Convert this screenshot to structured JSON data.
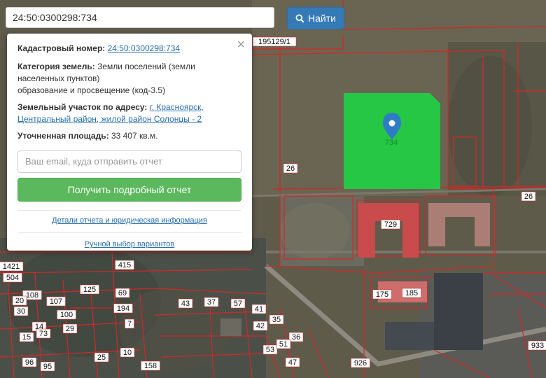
{
  "search": {
    "value": "24:50:0300298:734",
    "button_label": "Найти"
  },
  "popup": {
    "cadastral_label": "Кадастровый номер:",
    "cadastral_value": "24:50:0300298:734",
    "category_label": "Категория земель:",
    "category_value_1": "Земли поселений (земли населенных пунктов)",
    "category_value_2": "образование и просвещение (код-3.5)",
    "address_label": "Земельный участок по адресу:",
    "address_value": "г. Красноярск, Центральный район, жилой район Солонцы - 2",
    "area_label": "Уточненная площадь:",
    "area_value": "33 407 кв.м.",
    "email_placeholder": "Ваш email, куда отправить отчет",
    "report_button": "Получить подробный отчет",
    "details_link": "Детали отчета и юридическая информация",
    "manual_link": "Ручной выбор вариантов",
    "close_symbol": "×"
  },
  "map": {
    "selected_parcel_label": "734",
    "selected_color": "#22cc44",
    "parcel_line_color": "#cc2222",
    "marker_color": "#3b82c4",
    "parcel_labels": [
      "195129/1",
      "26",
      "26",
      "729",
      "185",
      "175",
      "415",
      "1421",
      "504",
      "108",
      "107",
      "100",
      "125",
      "69",
      "194",
      "43",
      "37",
      "57",
      "41",
      "35",
      "42",
      "36",
      "14",
      "29",
      "10",
      "73",
      "15",
      "7",
      "96",
      "95",
      "25",
      "158",
      "53",
      "51",
      "47",
      "926",
      "933",
      "20",
      "30"
    ]
  }
}
